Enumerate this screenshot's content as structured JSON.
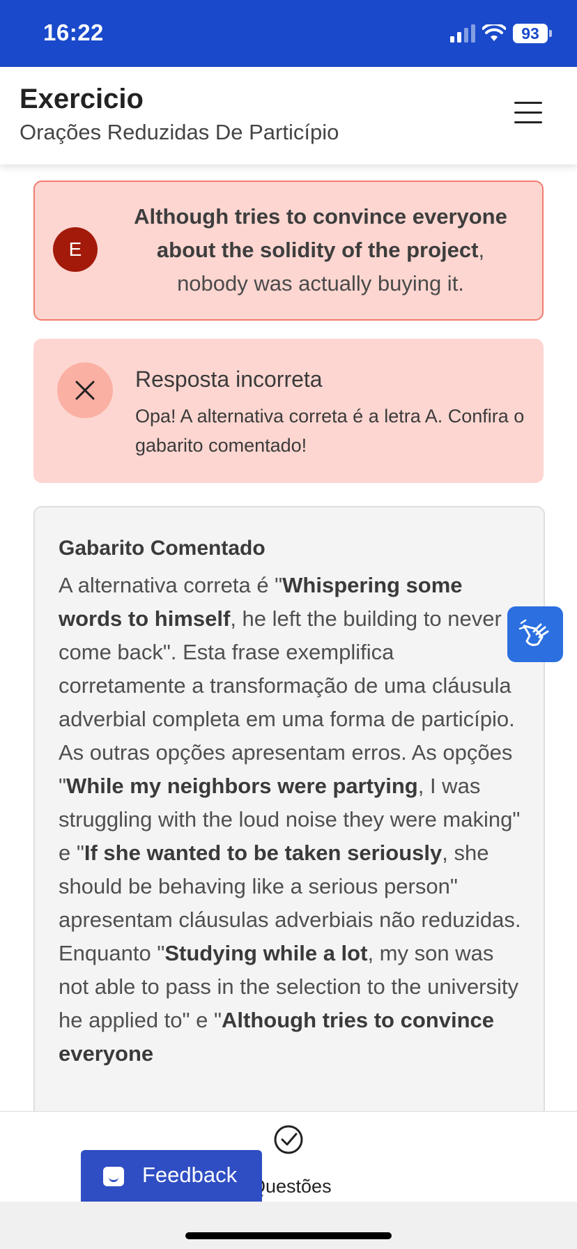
{
  "status_bar": {
    "time": "16:22",
    "battery": "93"
  },
  "header": {
    "title": "Exercicio",
    "subtitle": "Orações Reduzidas De Particípio"
  },
  "answer": {
    "letter": "E",
    "bold_text": "Although tries to convince everyone about the solidity of the project",
    "rest_text": ", nobody was actually buying it."
  },
  "result": {
    "title": "Resposta incorreta",
    "message": "Opa! A alternativa correta é a letra A. Confira o gabarito comentado!"
  },
  "gabarito": {
    "title": "Gabarito Comentado",
    "segments": [
      "A alternativa correta é \"",
      "Whispering some words to himself",
      ", he left the building to never come back\". Esta frase exemplifica corretamente a transformação de uma cláusula adverbial completa em uma forma de particípio. As outras opções apresentam erros. As opções \"",
      "While my neighbors were partying",
      ", I was struggling with the loud noise they were making\" e \"",
      "If she wanted to be taken seriously",
      ", she should be behaving like a serious person\" apresentam cláusulas adverbiais não reduzidas. Enquanto \"",
      "Studying while a lot",
      ", my son was not able to pass in the selection to the university he applied to\" e \"",
      "Although tries to convince everyone"
    ]
  },
  "bottom_nav": {
    "label": "Questões"
  },
  "feedback": {
    "label": "Feedback"
  },
  "colors": {
    "status_bar": "#1a4acb",
    "error_bg": "#fdd6d1",
    "feedback": "#2f4ec3",
    "libras": "#2b6fe0"
  }
}
